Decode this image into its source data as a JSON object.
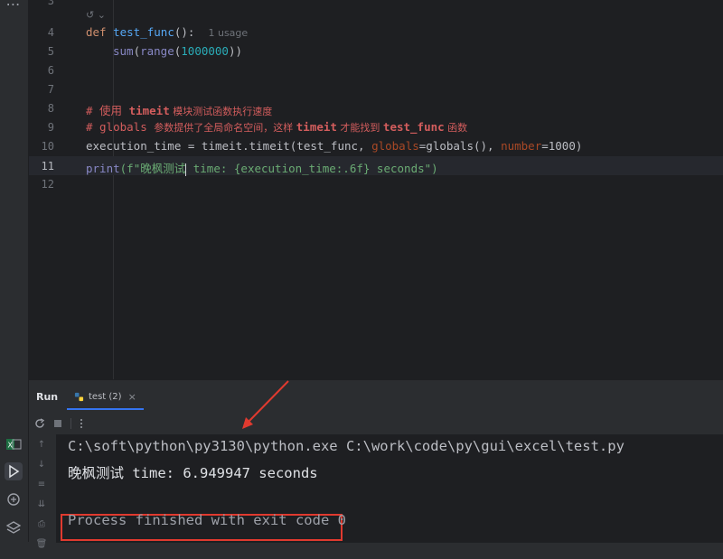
{
  "editor": {
    "lines": [
      {
        "n": "3",
        "text": ""
      },
      {
        "n": "4",
        "kw": "def ",
        "fn": "test_func",
        "rest": "():",
        "hint": "1 usage"
      },
      {
        "n": "5",
        "bi1": "sum",
        "p1": "(",
        "bi2": "range",
        "p2": "(",
        "num": "1000000",
        "p3": "))"
      },
      {
        "n": "6"
      },
      {
        "n": "7"
      },
      {
        "n": "8",
        "cmt1": "# 使用 ",
        "cmt2": "timeit",
        "cmt3": " 模块测试函数执行速度"
      },
      {
        "n": "9",
        "cmt1": "# globals ",
        "cmt2": "参数提供了全局命名空间，这样 ",
        "cmt3": "timeit",
        "cmt4": " 才能找到 ",
        "cmt5": "test_func",
        "cmt6": " 函数"
      },
      {
        "n": "10",
        "a": "execution_time = timeit.timeit(test_func, ",
        "p1": "globals",
        "b": "=globals(), ",
        "p2": "number",
        "c": "=1000)"
      },
      {
        "n": "11",
        "bi": "print",
        "a": "(f\"晚枫测试",
        "b": " time: {execution_time:.6f} seconds\")"
      },
      {
        "n": "12"
      }
    ],
    "fold_hint": "↺ ⌄"
  },
  "run_panel": {
    "title": "Run",
    "tab_label": "test (2)",
    "tab_close": "×",
    "console": {
      "command": "C:\\soft\\python\\py3130\\python.exe C:\\work\\code\\py\\gui\\excel\\test.py",
      "output": "晚枫测试 time: 6.949947 seconds",
      "exit": "Process finished with exit code 0"
    }
  },
  "colors": {
    "accent": "#3574f0",
    "annotation": "#e03a2f",
    "background": "#1e1f22"
  }
}
